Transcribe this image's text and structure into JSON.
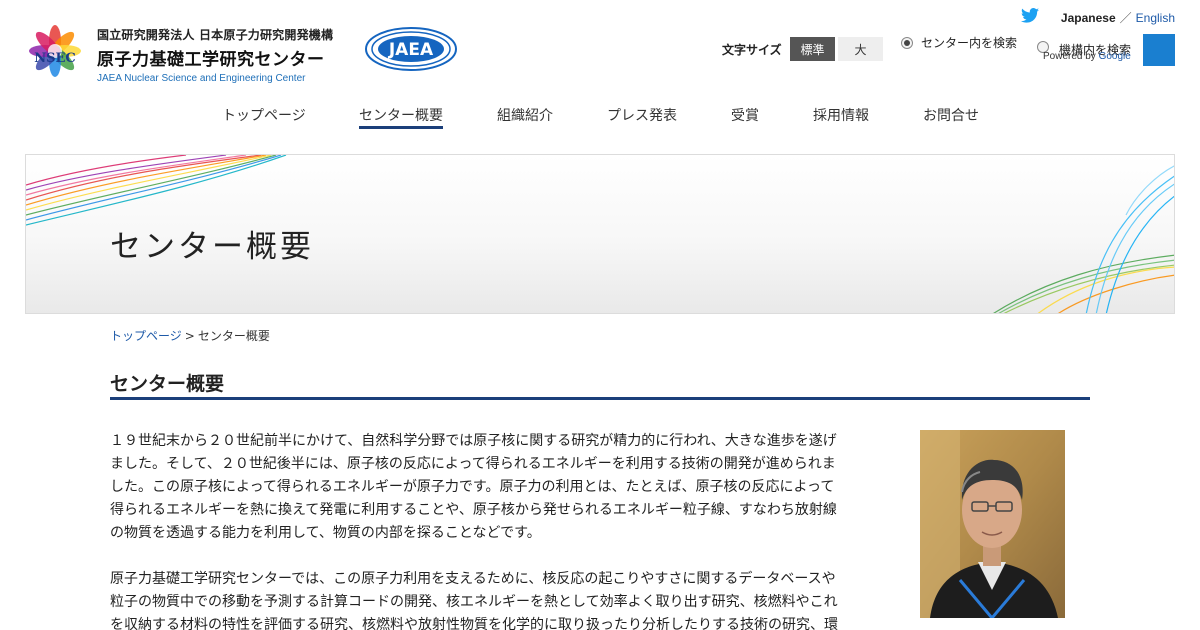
{
  "header": {
    "org_line1": "国立研究開発法人 日本原子力研究開発機構",
    "org_line2": "原子力基礎工学研究センター",
    "org_line3": "JAEA Nuclear Science and Engineering Center",
    "nsec_logo_text": "NSEC",
    "jaea_logo_text": "JAEA",
    "lang_japanese": "Japanese",
    "lang_sep": "／",
    "lang_english": "English",
    "font_size_label": "文字サイズ",
    "font_size_standard": "標準",
    "font_size_large": "大",
    "search_scope_center": "センター内を検索",
    "search_scope_agency": "機構内を検索",
    "powered_by": "Powered by",
    "powered_by_brand": "Google",
    "icons": {
      "twitter": "twitter-icon",
      "search": "search-icon"
    }
  },
  "nav": {
    "items": [
      {
        "label": "トップページ"
      },
      {
        "label": "センター概要"
      },
      {
        "label": "組織紹介"
      },
      {
        "label": "プレス発表"
      },
      {
        "label": "受賞"
      },
      {
        "label": "採用情報"
      },
      {
        "label": "お問合せ"
      }
    ],
    "active_index": 1
  },
  "banner": {
    "title": "センター概要"
  },
  "breadcrumb": {
    "home": "トップページ",
    "separator": ">",
    "current": "センター概要"
  },
  "main": {
    "title": "センター概要",
    "paragraph1_lines": [
      "１９世紀末から２０世紀前半にかけて、自然科学分野では原子核に関する研究が精力的に行われ、大きな進歩を遂げ",
      "ました。そして、２０世紀後半には、原子核の反応によって得られるエネルギーを利用する技術の開発が進められま",
      "した。この原子核によって得られるエネルギーが原子力です。原子力の利用とは、たとえば、原子核の反応によって",
      "得られるエネルギーを熱に換えて発電に利用することや、原子核から発せられるエネルギー粒子線、すなわち放射線",
      "の物質を透過する能力を利用して、物質の内部を探ることなどです。"
    ],
    "paragraph2_lines": [
      "原子力基礎工学研究センターでは、この原子力利用を支えるために、核反応の起こりやすさに関するデータベースや",
      "粒子の物質中での移動を予測する計算コードの開発、核エネルギーを熱として効率よく取り出す研究、核燃料やこれ",
      "を収納する材料の特性を評価する研究、核燃料や放射性物質を化学的に取り扱ったり分析したりする技術の研究、環"
    ]
  },
  "colors": {
    "accent_navy": "#1b3f7a",
    "link_blue": "#1e5aa8",
    "search_button": "#1a7fd0",
    "font_btn_active": "#555555",
    "twitter_blue": "#1da1f2"
  }
}
